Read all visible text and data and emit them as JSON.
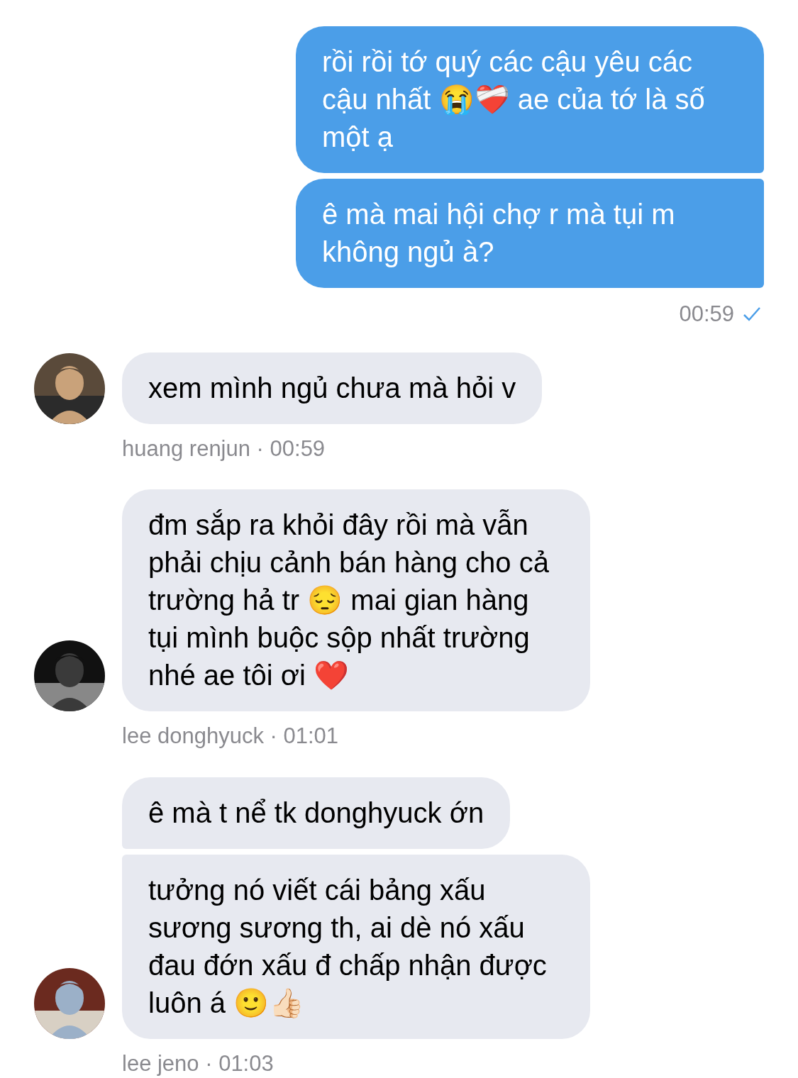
{
  "sent": {
    "messages": [
      "rồi rồi tớ quý các cậu yêu các cậu nhất 😭❤️‍🩹 ae của tớ là số một ạ",
      "ê mà mai hội chợ r mà tụi m không ngủ à?"
    ],
    "time": "00:59",
    "read": true
  },
  "received": [
    {
      "meta": "huang renjun · 00:59",
      "messages": [
        "xem mình ngủ chưa mà hỏi v"
      ]
    },
    {
      "meta": "lee donghyuck · 01:01",
      "messages": [
        "đm sắp ra khỏi đây rồi mà vẫn phải chịu cảnh bán hàng cho cả trường hả tr 😔 mai gian hàng tụi mình buộc sộp nhất trường nhé ae tôi ơi ❤️"
      ]
    },
    {
      "meta": "lee jeno · 01:03",
      "messages": [
        "ê mà t nể tk donghyuck ớn",
        "tưởng nó viết cái bảng xấu sương sương th, ai dè nó xấu đau đớn xấu đ chấp nhận được luôn á 🙂👍🏻"
      ]
    }
  ]
}
